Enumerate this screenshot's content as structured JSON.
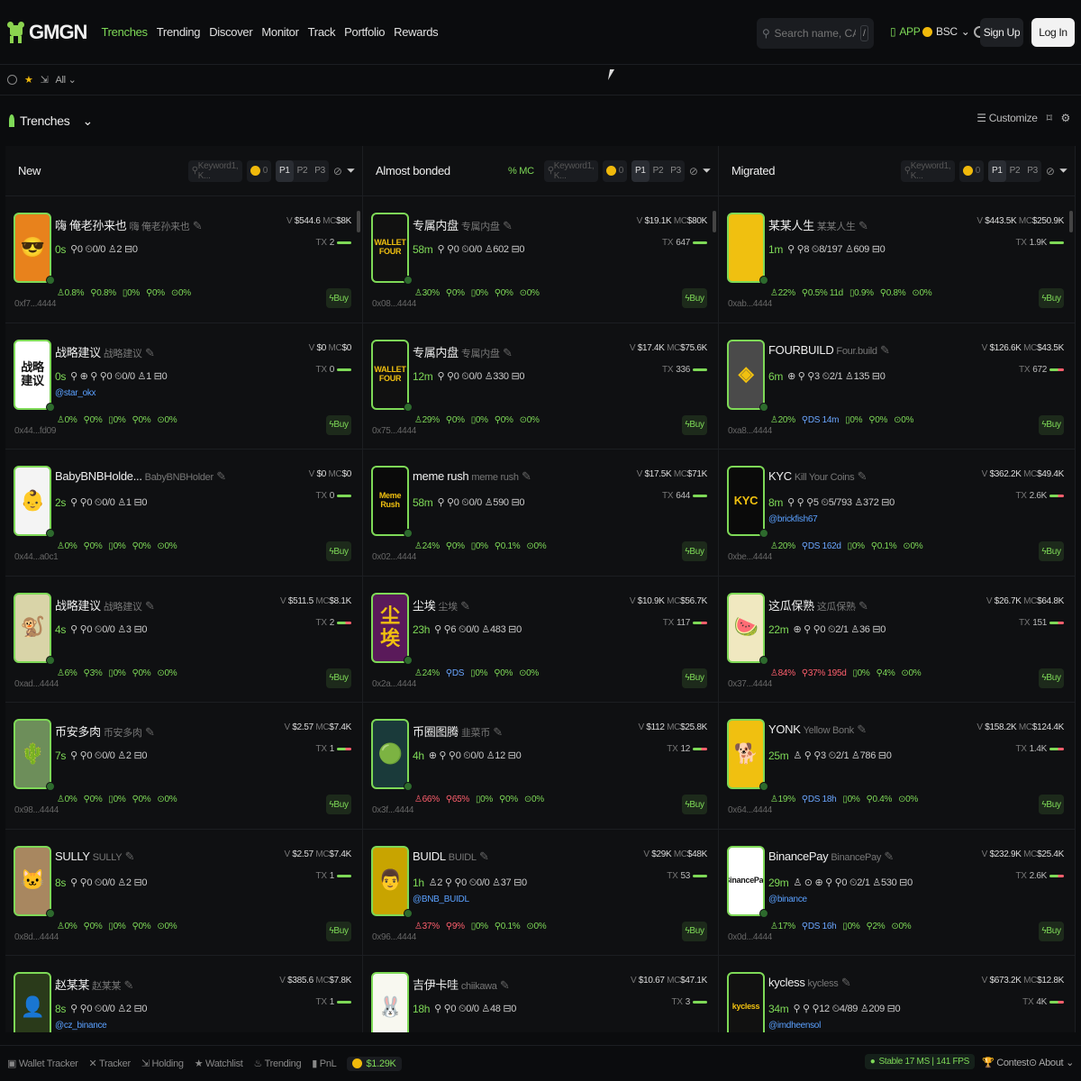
{
  "nav": {
    "logo": "GMGN",
    "links": [
      "Trenches",
      "Trending",
      "Discover",
      "Monitor",
      "Track",
      "Portfolio",
      "Rewards"
    ],
    "search_placeholder": "Search name, CA, wallet",
    "search_kbd": "/",
    "app_label": "APP",
    "chain_label": "BSC",
    "signup": "Sign Up",
    "login": "Log In"
  },
  "subbar": {
    "filter": "All"
  },
  "page": {
    "title": "Trenches",
    "customize": "Customize"
  },
  "columns": [
    {
      "title": "New",
      "keyword_placeholder": "Keyword1, K...",
      "amount": "0",
      "presets": [
        "P1",
        "P2",
        "P3"
      ],
      "cards": [
        {
          "name": "嗨 俺老孙来也",
          "sub": "嗨 俺老孙来也",
          "age": "0s",
          "meta": "⚲0 ⏲0/0 ♙2 ⊟0",
          "handle": "",
          "addr": "0xf7...4444",
          "vol": "$544.6",
          "mc": "$8K",
          "tx": "2",
          "stats": [
            "0.8%",
            "0.8%",
            "0%",
            "0%",
            "0%"
          ],
          "img_text": "😎",
          "img_bg": "#e8821c"
        },
        {
          "name": "战略建议",
          "sub": "战略建议",
          "age": "0s",
          "meta": "⚲ ⊕ ⚲ ⚲0 ⏲0/0 ♙1 ⊟0",
          "handle": "@star_okx",
          "addr": "0x44...fd09",
          "vol": "$0",
          "mc": "$0",
          "tx": "0",
          "stats": [
            "0%",
            "0%",
            "0%",
            "0%",
            "0%"
          ],
          "img_text": "战略建议",
          "img_bg": "#ffffff"
        },
        {
          "name": "BabyBNBHolde...",
          "sub": "BabyBNBHolder",
          "age": "2s",
          "meta": "⚲ ⚲0 ⏲0/0 ♙1 ⊟0",
          "handle": "",
          "addr": "0x44...a0c1",
          "vol": "$0",
          "mc": "$0",
          "tx": "0",
          "stats": [
            "0%",
            "0%",
            "0%",
            "0%",
            "0%"
          ],
          "img_text": "👶",
          "img_bg": "#f4f4f4"
        },
        {
          "name": "战略建议",
          "sub": "战略建议",
          "age": "4s",
          "meta": "⚲ ⚲0 ⏲0/0 ♙3 ⊟0",
          "handle": "",
          "addr": "0xad...4444",
          "vol": "$511.5",
          "mc": "$8.1K",
          "tx": "2",
          "stats": [
            "6%",
            "3%",
            "0%",
            "0%",
            "0%"
          ],
          "img_text": "🐒",
          "img_bg": "#d9d4a8"
        },
        {
          "name": "币安多肉",
          "sub": "币安多肉",
          "age": "7s",
          "meta": "⚲ ⚲0 ⏲0/0 ♙2 ⊟0",
          "handle": "",
          "addr": "0x98...4444",
          "vol": "$2.57",
          "mc": "$7.4K",
          "tx": "1",
          "stats": [
            "0%",
            "0%",
            "0%",
            "0%",
            "0%"
          ],
          "img_text": "🌵",
          "img_bg": "#6d8e5a"
        },
        {
          "name": "SULLY",
          "sub": "SULLY",
          "age": "8s",
          "meta": "⚲ ⚲0 ⏲0/0 ♙2 ⊟0",
          "handle": "",
          "addr": "0x8d...4444",
          "vol": "$2.57",
          "mc": "$7.4K",
          "tx": "1",
          "stats": [
            "0%",
            "0%",
            "0%",
            "0%",
            "0%"
          ],
          "img_text": "🐱",
          "img_bg": "#a88760"
        },
        {
          "name": "赵某某",
          "sub": "赵某某",
          "age": "8s",
          "meta": "⚲ ⚲0 ⏲0/0 ♙2 ⊟0",
          "handle": "@cz_binance",
          "addr": "",
          "vol": "$385.6",
          "mc": "$7.8K",
          "tx": "1",
          "stats": [],
          "img_text": "👤",
          "img_bg": "#2a3a1a"
        }
      ]
    },
    {
      "title": "Almost bonded",
      "mc_label": "% MC",
      "keyword_placeholder": "Keyword1, K...",
      "amount": "0",
      "presets": [
        "P1",
        "P2",
        "P3"
      ],
      "cards": [
        {
          "name": "专属内盘",
          "sub": "专属内盘",
          "age": "58m",
          "meta": "⚲ ⚲0 ⏲0/0 ♙602 ⊟0",
          "handle": "",
          "addr": "0x08...4444",
          "vol": "$19.1K",
          "mc": "$80K",
          "tx": "647",
          "stats": [
            "30%",
            "0%",
            "0%",
            "0%",
            "0%"
          ],
          "img_text": "WALLET FOUR",
          "img_bg": "#111111"
        },
        {
          "name": "专属内盘",
          "sub": "专属内盘",
          "age": "12m",
          "meta": "⚲ ⚲0 ⏲0/0 ♙330 ⊟0",
          "handle": "",
          "addr": "0x75...4444",
          "vol": "$17.4K",
          "mc": "$75.6K",
          "tx": "336",
          "stats": [
            "29%",
            "0%",
            "0%",
            "0%",
            "0%"
          ],
          "img_text": "WALLET FOUR",
          "img_bg": "#111111"
        },
        {
          "name": "meme rush",
          "sub": "meme rush",
          "age": "58m",
          "meta": "⚲ ⚲0 ⏲0/0 ♙590 ⊟0",
          "handle": "",
          "addr": "0x02...4444",
          "vol": "$17.5K",
          "mc": "$71K",
          "tx": "644",
          "stats": [
            "24%",
            "0%",
            "0%",
            "0.1%",
            "0%"
          ],
          "img_text": "Meme Rush",
          "img_bg": "#0a0a0a"
        },
        {
          "name": "尘埃",
          "sub": "尘埃",
          "age": "23h",
          "meta": "⚲ ⚲6 ⏲0/0 ♙483 ⊟0",
          "handle": "",
          "addr": "0x2a...4444",
          "vol": "$10.9K",
          "mc": "$56.7K",
          "tx": "117",
          "stats": [
            "24%",
            "DS",
            "0%",
            "0%",
            "0%"
          ],
          "img_text": "尘埃",
          "img_bg": "#5a1a5a"
        },
        {
          "name": "币圈图腾",
          "sub": "韭菜币",
          "age": "4h",
          "meta": "⊕ ⚲ ⚲0 ⏲0/0 ♙12 ⊟0",
          "handle": "",
          "addr": "0x3f...4444",
          "vol": "$112",
          "mc": "$25.8K",
          "tx": "12",
          "stats": [
            "66%",
            "65%",
            "0%",
            "0%",
            "0%"
          ],
          "img_text": "🟢",
          "img_bg": "#1a3a3a"
        },
        {
          "name": "BUIDL",
          "sub": "BUIDL",
          "age": "1h",
          "meta": "♙2 ⚲ ⚲0 ⏲0/0 ♙37 ⊟0",
          "handle": "@BNB_BUIDL",
          "addr": "0x96...4444",
          "vol": "$29K",
          "mc": "$48K",
          "tx": "53",
          "stats": [
            "37%",
            "9%",
            "0%",
            "0.1%",
            "0%"
          ],
          "img_text": "👨",
          "img_bg": "#c8a400"
        },
        {
          "name": "吉伊卡哇",
          "sub": "chiikawa",
          "age": "18h",
          "meta": "⚲ ⚲0 ⏲0/0 ♙48 ⊟0",
          "handle": "",
          "addr": "",
          "vol": "$10.67",
          "mc": "$47.1K",
          "tx": "3",
          "stats": [],
          "img_text": "🐰",
          "img_bg": "#f8f8f0"
        }
      ]
    },
    {
      "title": "Migrated",
      "keyword_placeholder": "Keyword1, K...",
      "amount": "0",
      "presets": [
        "P1",
        "P2",
        "P3"
      ],
      "cards": [
        {
          "name": "某某人生",
          "sub": "某某人生",
          "age": "1m",
          "meta": "⚲ ⚲8 ⏲8/197 ♙609 ⊟0",
          "handle": "",
          "addr": "0xab...4444",
          "vol": "$443.5K",
          "mc": "$250.9K",
          "tx": "1.9K",
          "stats": [
            "22%",
            "0.5% 11d",
            "0.9%",
            "0.8%",
            "0%"
          ],
          "img_text": "某某人生",
          "img_bg": "#f0c010"
        },
        {
          "name": "FOURBUILD",
          "sub": "Four.build",
          "age": "6m",
          "meta": "⊕ ⚲ ⚲3 ⏲2/1 ♙135 ⊟0",
          "handle": "",
          "addr": "0xa8...4444",
          "vol": "$126.6K",
          "mc": "$43.5K",
          "tx": "672",
          "stats": [
            "20%",
            "DS 14m",
            "0%",
            "0%",
            "0%"
          ],
          "img_text": "◈",
          "img_bg": "#4a4a4a"
        },
        {
          "name": "KYC",
          "sub": "Kill Your Coins",
          "age": "8m",
          "meta": "⚲ ⚲ ⚲5 ⏲5/793 ♙372 ⊟0",
          "handle": "@brickfish67",
          "addr": "0xbe...4444",
          "vol": "$362.2K",
          "mc": "$49.4K",
          "tx": "2.6K",
          "stats": [
            "20%",
            "DS 162d",
            "0%",
            "0.1%",
            "0%"
          ],
          "img_text": "KYC",
          "img_bg": "#0a0a0a"
        },
        {
          "name": "这瓜保熟",
          "sub": "这瓜保熟",
          "age": "22m",
          "meta": "⊕ ⚲ ⚲0 ⏲2/1 ♙36 ⊟0",
          "handle": "",
          "addr": "0x37...4444",
          "vol": "$26.7K",
          "mc": "$64.8K",
          "tx": "151",
          "stats": [
            "84%",
            "37% 195d",
            "0%",
            "4%",
            "0%"
          ],
          "img_text": "🍉",
          "img_bg": "#f0e8c0"
        },
        {
          "name": "YONK",
          "sub": "Yellow Bonk",
          "age": "25m",
          "meta": "♙ ⚲ ⚲3 ⏲2/1 ♙786 ⊟0",
          "handle": "",
          "addr": "0x64...4444",
          "vol": "$158.2K",
          "mc": "$124.4K",
          "tx": "1.4K",
          "stats": [
            "19%",
            "DS 18h",
            "0%",
            "0.4%",
            "0%"
          ],
          "img_text": "🐕",
          "img_bg": "#f0c010"
        },
        {
          "name": "BinancePay",
          "sub": "BinancePay",
          "age": "29m",
          "meta": "♙ ⊙ ⊕ ⚲ ⚲0 ⏲2/1 ♙530 ⊟0",
          "handle": "@binance",
          "addr": "0x0d...4444",
          "vol": "$232.9K",
          "mc": "$25.4K",
          "tx": "2.6K",
          "stats": [
            "17%",
            "DS 16h",
            "0%",
            "2%",
            "0%"
          ],
          "img_text": "BinancePay",
          "img_bg": "#ffffff"
        },
        {
          "name": "kycless",
          "sub": "kycless",
          "age": "34m",
          "meta": "⚲ ⚲ ⚲12 ⏲4/89 ♙209 ⊟0",
          "handle": "@imdheensol",
          "addr": "",
          "vol": "$673.2K",
          "mc": "$12.8K",
          "tx": "4K",
          "stats": [],
          "img_text": "kycless",
          "img_bg": "#111111"
        }
      ]
    }
  ],
  "labels": {
    "tx_prefix": "TX",
    "mc_prefix": "MC",
    "buy": "Buy"
  },
  "footer": {
    "items": [
      "Wallet Tracker",
      "Tracker",
      "Holding",
      "Watchlist",
      "Trending",
      "PnL"
    ],
    "balance": "$1.29K",
    "stable": "Stable 17 MS | 141 FPS",
    "contest": "Contest",
    "about": "About"
  },
  "colors": {
    "accent": "#7ed957",
    "danger": "#ff5f6d",
    "link": "#5aa0ff",
    "bg": "#0b0c0e"
  }
}
